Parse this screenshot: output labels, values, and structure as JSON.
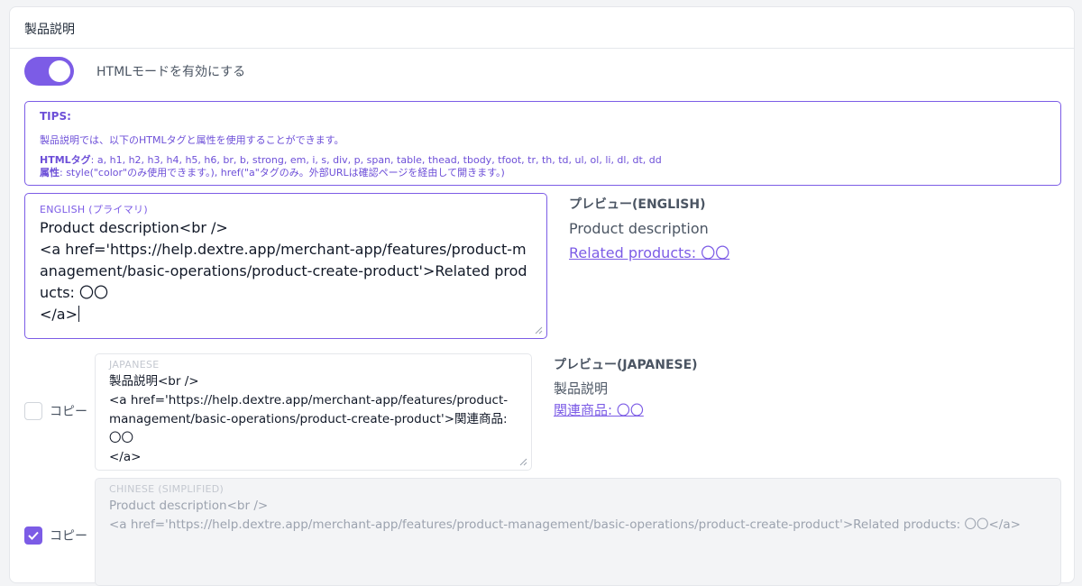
{
  "header": {
    "title": "製品説明"
  },
  "html_mode": {
    "label": "HTMLモードを有効にする",
    "enabled": true
  },
  "tips": {
    "title": "TIPS:",
    "intro": "製品説明では、以下のHTMLタグと属性を使用することができます。",
    "tags_label": "HTMLタグ",
    "tags_value": ":  a, h1, h2, h3, h4, h5, h6, br, b, strong, em, i, s, div, p, span, table, thead, tbody, tfoot, tr, th, td, ul, ol, li, dl, dt, dd",
    "attrs_label": "属性",
    "attrs_value": ":  style(\"color\"のみ使用できます。), href(\"a\"タグのみ。外部URLは確認ページを経由して開きます。)"
  },
  "english": {
    "label": "ENGLISH (プライマリ)",
    "value": "Product description<br />\n<a href='https://help.dextre.app/merchant-app/features/product-management/basic-operations/product-create-product'>Related products: 〇〇\n</a>",
    "preview_title": "プレビュー(ENGLISH)",
    "preview_text": "Product description",
    "preview_link": "Related products: 〇〇"
  },
  "japanese": {
    "label": "JAPANESE",
    "value": "製品説明<br />\n<a href='https://help.dextre.app/merchant-app/features/product-management/basic-operations/product-create-product'>関連商品: 〇〇\n</a>",
    "copy_label": "コピー",
    "copy_checked": false,
    "preview_title": "プレビュー(JAPANESE)",
    "preview_text": "製品説明",
    "preview_link": "関連商品: 〇〇"
  },
  "chinese": {
    "label": "CHINESE (SIMPLIFIED)",
    "value": "Product description<br />\n<a href='https://help.dextre.app/merchant-app/features/product-management/basic-operations/product-create-product'>Related products: 〇〇</a>",
    "copy_label": "コピー",
    "copy_checked": true
  },
  "colors": {
    "accent": "#7c5ce6",
    "border": "#e5e7eb",
    "disabled_bg": "#f3f4f6"
  }
}
